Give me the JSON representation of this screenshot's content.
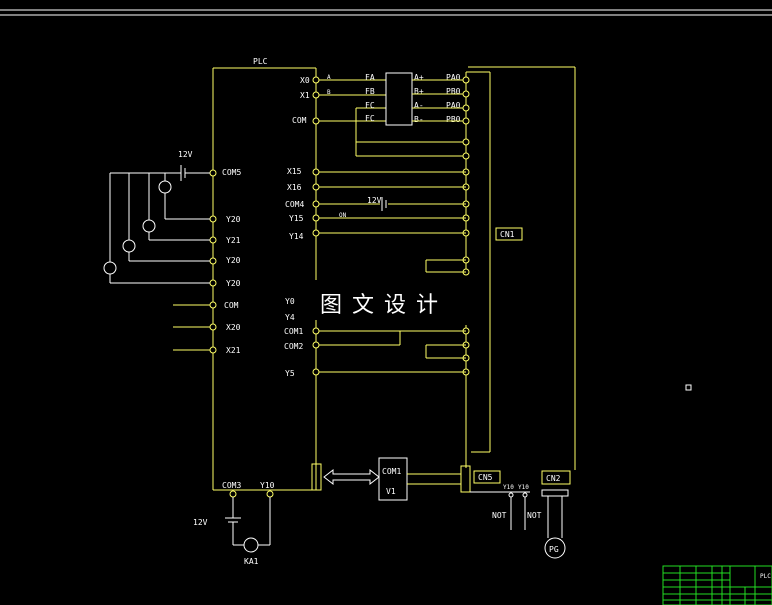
{
  "watermark": "图文设计",
  "plc_label": "PLC",
  "plc_inputs": [
    "X0",
    "X1",
    "COM"
  ],
  "plc_left_terms": [
    "COM5",
    "Y20",
    "Y21",
    "Y20",
    "Y20",
    "COM",
    "X20",
    "X21"
  ],
  "plc_right_terms": [
    "X15",
    "X16",
    "COM4",
    "Y15",
    "Y14"
  ],
  "plc_lower_terms": [
    "Y0",
    "Y4",
    "COM1",
    "COM2",
    "Y5"
  ],
  "plc_bottom_terms": [
    "COM3",
    "Y10"
  ],
  "encoder_signals": [
    "FA",
    "FB",
    "FC",
    "FC"
  ],
  "encoder_outputs": [
    "A+",
    "B+",
    "A-",
    "B-"
  ],
  "encoder_pins": [
    "PA0",
    "PB0",
    "PA0",
    "PB0"
  ],
  "voltage_top": "12V",
  "voltage_mid": "12V",
  "voltage_bottom": "12V",
  "relay_label": "KA1",
  "y10_left": "Y10",
  "y10_right": "Y10",
  "not_left": "NOT",
  "not_right": "NOT",
  "connectors": {
    "cn1": "CN1",
    "cn2": "CN2",
    "cn5": "CN5"
  },
  "module": {
    "com": "COM1",
    "v": "V1"
  },
  "pg": "PG",
  "mid_label_on": "ON",
  "title_block_text": "PLC"
}
